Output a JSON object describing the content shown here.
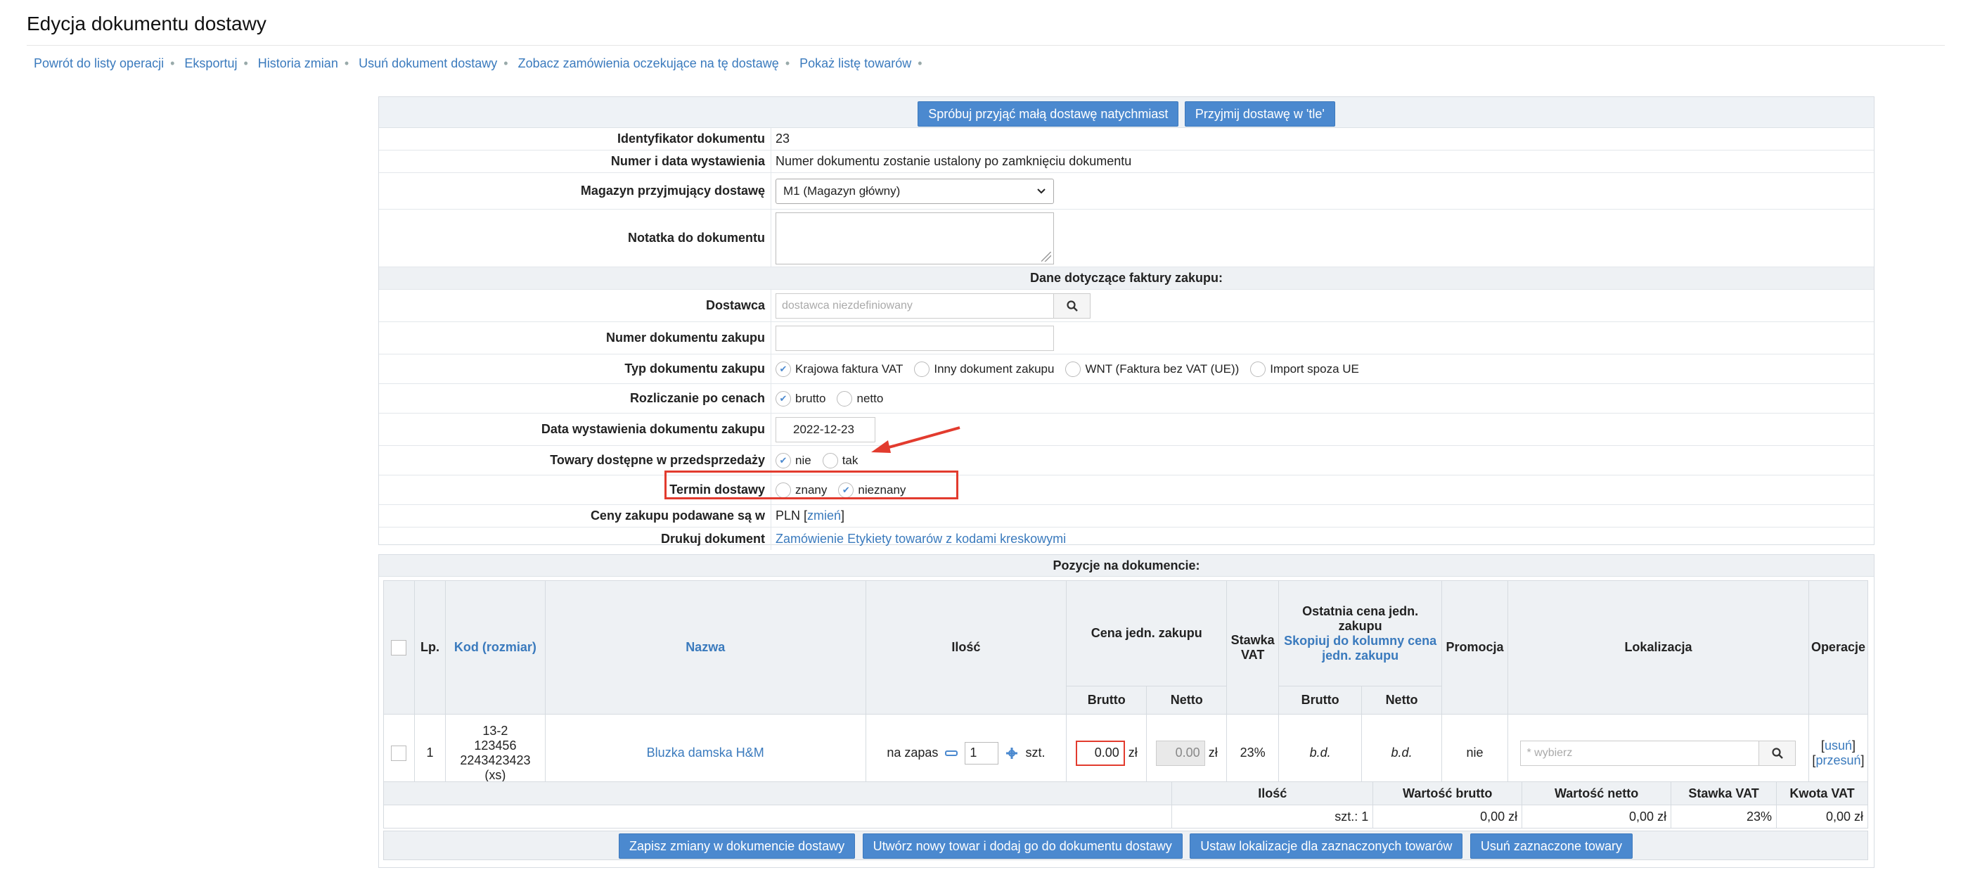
{
  "page": {
    "title": "Edycja dokumentu dostawy"
  },
  "actions": [
    "Powrót do listy operacji",
    "Eksportuj",
    "Historia zmian",
    "Usuń dokument dostawy",
    "Zobacz zamówienia oczekujące na tę dostawę",
    "Pokaż listę towarów"
  ],
  "top_buttons": {
    "quick_receive": "Spróbuj przyjąć małą dostawę natychmiast",
    "background_receive": "Przyjmij dostawę w 'tle'"
  },
  "form": {
    "doc_id": {
      "label": "Identyfikator dokumentu",
      "value": "23"
    },
    "doc_number": {
      "label": "Numer i data wystawienia",
      "value": "Numer dokumentu zostanie ustalony po zamknięciu dokumentu"
    },
    "warehouse": {
      "label": "Magazyn przyjmujący dostawę",
      "value": "M1 (Magazyn główny)"
    },
    "note": {
      "label": "Notatka do dokumentu"
    },
    "invoice_section": "Dane dotyczące faktury zakupu:",
    "supplier": {
      "label": "Dostawca",
      "placeholder": "dostawca niezdefiniowany"
    },
    "purchase_number": {
      "label": "Numer dokumentu zakupu"
    },
    "doc_type": {
      "label": "Typ dokumentu zakupu",
      "options": [
        "Krajowa faktura VAT",
        "Inny dokument zakupu",
        "WNT (Faktura bez VAT (UE))",
        "Import spoza UE"
      ],
      "selected": "Krajowa faktura VAT"
    },
    "pricing": {
      "label": "Rozliczanie po cenach",
      "options": [
        "brutto",
        "netto"
      ],
      "selected": "brutto"
    },
    "issue_date": {
      "label": "Data wystawienia dokumentu zakupu",
      "value": "2022-12-23"
    },
    "presale": {
      "label": "Towary dostępne w przedsprzedaży",
      "options": [
        "nie",
        "tak"
      ],
      "selected": "nie"
    },
    "delivery_term": {
      "label": "Termin dostawy",
      "options": [
        "znany",
        "nieznany"
      ],
      "selected": "nieznany"
    },
    "currency": {
      "label": "Ceny zakupu podawane są w",
      "value": "PLN",
      "change_link": "zmień"
    },
    "print": {
      "label": "Drukuj dokument",
      "links": [
        "Zamówienie",
        "Etykiety towarów z kodami kreskowymi"
      ]
    }
  },
  "items": {
    "title": "Pozycje na dokumencie:",
    "headers": {
      "lp": "Lp.",
      "code": "Kod (rozmiar)",
      "name": "Nazwa",
      "qty": "Ilość",
      "unit_price": "Cena jedn. zakupu",
      "vat": "Stawka VAT",
      "last_price": "Ostatnia cena jedn. zakupu",
      "copy_link": "Skopiuj do kolumny cena jedn. zakupu",
      "promo": "Promocja",
      "location": "Lokalizacja",
      "operations": "Operacje",
      "gross": "Brutto",
      "net": "Netto"
    },
    "rows": [
      {
        "lp": "1",
        "code_lines": [
          "13-2",
          "123456",
          "2243423423",
          "(xs)"
        ],
        "name": "Bluzka damska H&M",
        "qty_mode": "na zapas",
        "qty": "1",
        "unit": "szt.",
        "gross": "0.00",
        "net": "0.00",
        "currency": "zł",
        "vat": "23%",
        "last_gross": "b.d.",
        "last_net": "b.d.",
        "promo": "nie",
        "location_placeholder": "* wybierz",
        "op_delete": "usuń",
        "op_move": "przesuń"
      }
    ]
  },
  "summary": {
    "headers": [
      "Ilość",
      "Wartość brutto",
      "Wartość netto",
      "Stawka VAT",
      "Kwota VAT"
    ],
    "values": [
      "szt.: 1",
      "0,00 zł",
      "0,00 zł",
      "23%",
      "0,00 zł"
    ]
  },
  "bottom_buttons": {
    "save": "Zapisz zmiany w dokumencie dostawy",
    "create": "Utwórz nowy towar i dodaj go do dokumentu dostawy",
    "set_location": "Ustaw lokalizacje dla zaznaczonych towarów",
    "remove": "Usuń zaznaczone towary"
  },
  "colors": {
    "accent": "#4b89cf",
    "link": "#3a7abd",
    "highlight": "#e23b2e"
  },
  "icons": [
    "search-icon",
    "chevron-down-icon",
    "minus-icon",
    "plus-icon",
    "arrow-annotation"
  ]
}
